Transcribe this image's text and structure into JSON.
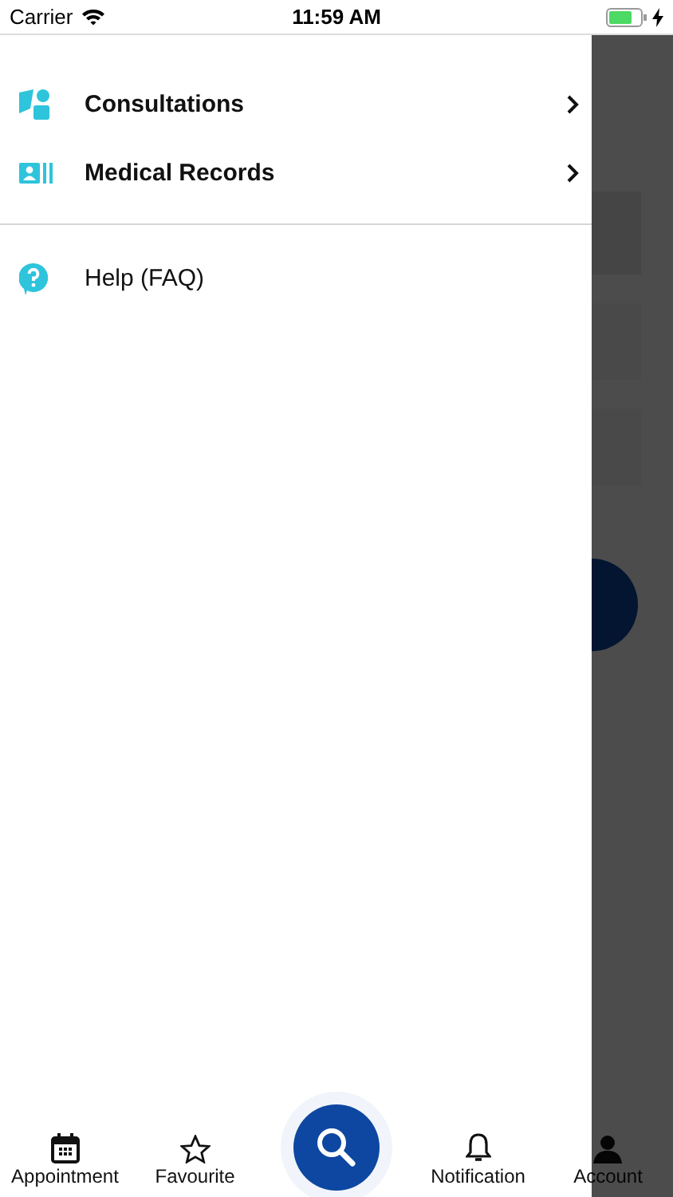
{
  "status_bar": {
    "carrier": "Carrier",
    "time": "11:59 AM"
  },
  "menu_sections": [
    {
      "items": [
        {
          "label": "Consultations",
          "kind": "nav"
        },
        {
          "label": "Medical Records",
          "kind": "nav"
        }
      ]
    },
    {
      "items": [
        {
          "label": "Help (FAQ)",
          "kind": "plain"
        }
      ]
    }
  ],
  "tab_bar": {
    "tabs": [
      {
        "label": "Appointment"
      },
      {
        "label": "Favourite"
      },
      {
        "label": "Notification"
      },
      {
        "label": "Account"
      }
    ]
  }
}
